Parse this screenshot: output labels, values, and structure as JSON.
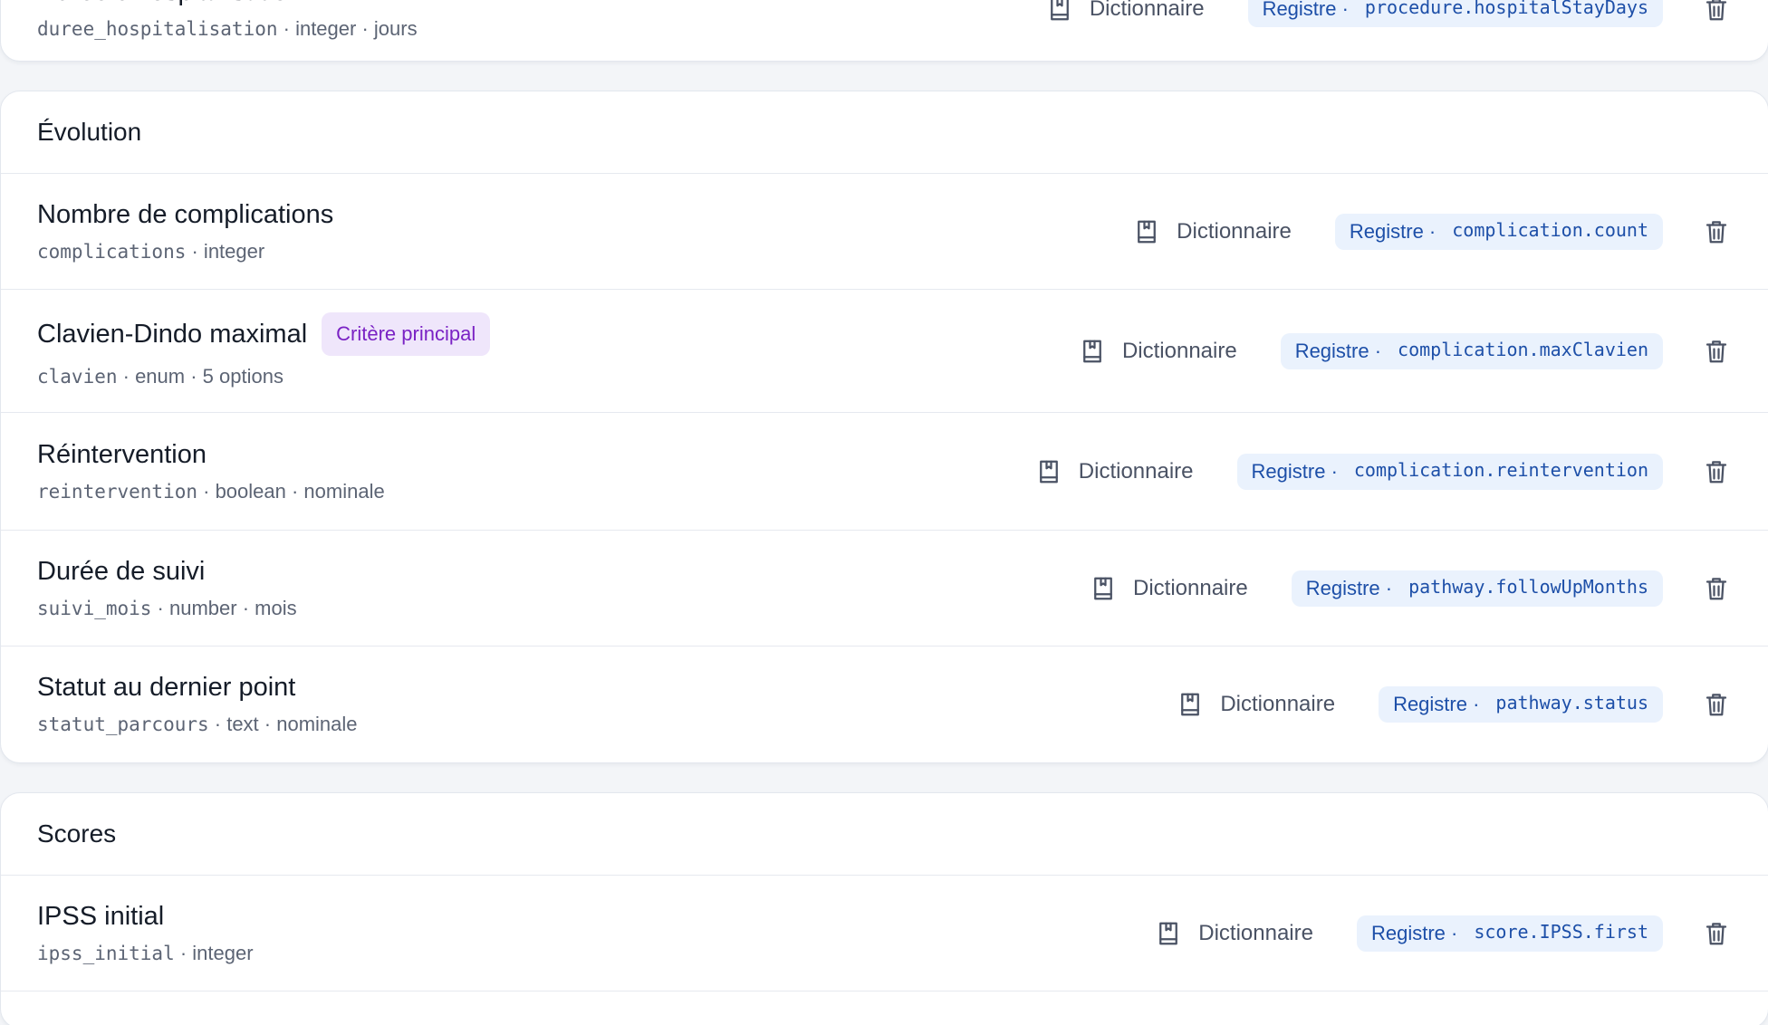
{
  "sections": [
    {
      "title": "",
      "rows": [
        {
          "title": "Durée d'hospitalisation",
          "field_key": "duree_hospitalisation",
          "meta_suffix": " · integer · jours",
          "dict_label": "Dictionnaire",
          "registry_label": "Registre ·",
          "registry_path": "procedure.hospitalStayDays"
        }
      ]
    },
    {
      "title": "Évolution",
      "rows": [
        {
          "title": "Nombre de complications",
          "field_key": "complications",
          "meta_suffix": " · integer",
          "dict_label": "Dictionnaire",
          "registry_label": "Registre ·",
          "registry_path": "complication.count"
        },
        {
          "title": "Clavien-Dindo maximal",
          "badge": "Critère principal",
          "field_key": "clavien",
          "meta_suffix": " · enum · 5 options",
          "dict_label": "Dictionnaire",
          "registry_label": "Registre ·",
          "registry_path": "complication.maxClavien"
        },
        {
          "title": "Réintervention",
          "field_key": "reintervention",
          "meta_suffix": " · boolean · nominale",
          "dict_label": "Dictionnaire",
          "registry_label": "Registre ·",
          "registry_path": "complication.reintervention"
        },
        {
          "title": "Durée de suivi",
          "field_key": "suivi_mois",
          "meta_suffix": " · number · mois",
          "dict_label": "Dictionnaire",
          "registry_label": "Registre ·",
          "registry_path": "pathway.followUpMonths"
        },
        {
          "title": "Statut au dernier point",
          "field_key": "statut_parcours",
          "meta_suffix": " · text · nominale",
          "dict_label": "Dictionnaire",
          "registry_label": "Registre ·",
          "registry_path": "pathway.status"
        }
      ]
    },
    {
      "title": "Scores",
      "rows": [
        {
          "title": "IPSS initial",
          "field_key": "ipss_initial",
          "meta_suffix": " · integer",
          "dict_label": "Dictionnaire",
          "registry_label": "Registre ·",
          "registry_path": "score.IPSS.first"
        }
      ]
    }
  ],
  "icons": {
    "dictionary": "book-icon",
    "delete": "trash-icon"
  },
  "colors": {
    "badge_bg": "#efe6fb",
    "badge_text": "#7a22c4",
    "registry_bg": "#eaf2fd",
    "registry_text": "#1d4fa8"
  }
}
